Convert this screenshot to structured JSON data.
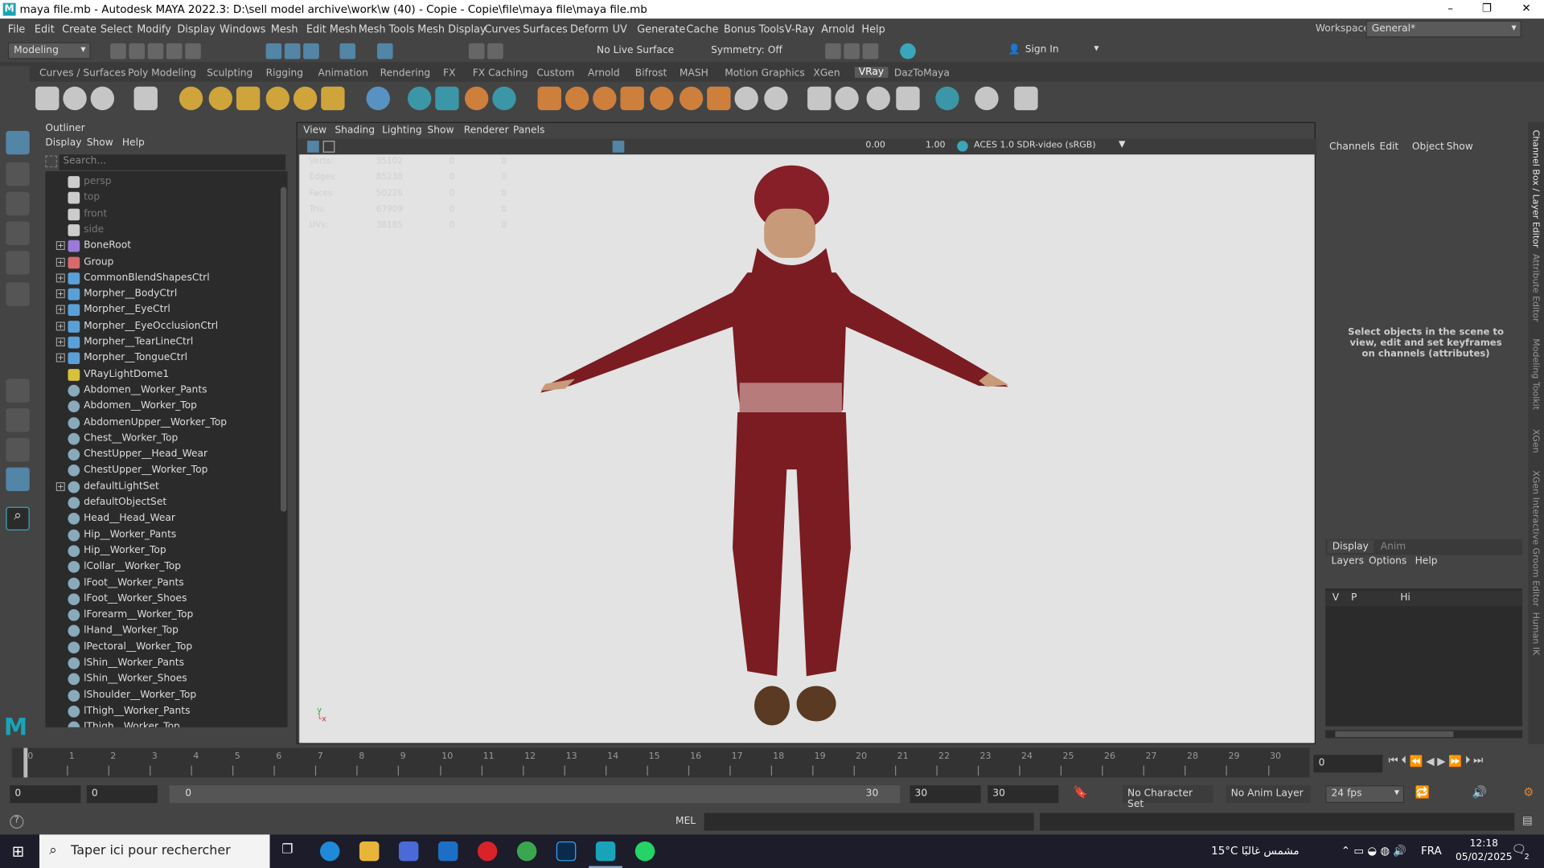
{
  "window": {
    "title": "maya file.mb - Autodesk MAYA 2022.3: D:\\sell model archive\\work\\w (40) - Copie - Copie\\file\\maya file\\maya file.mb"
  },
  "menus": [
    "File",
    "Edit",
    "Create",
    "Select",
    "Modify",
    "Display",
    "Windows",
    "Mesh",
    "Edit Mesh",
    "Mesh Tools",
    "Mesh Display",
    "Curves",
    "Surfaces",
    "Deform",
    "UV",
    "Generate",
    "Cache",
    "Bonus Tools",
    "V-Ray",
    "Arnold",
    "Help"
  ],
  "workspace": {
    "label": "Workspace:",
    "value": "General*"
  },
  "status": {
    "mode": "Modeling",
    "live_surface": "No Live Surface",
    "symmetry": "Symmetry: Off",
    "sign_in": "Sign In"
  },
  "shelf_tabs": [
    "Curves / Surfaces",
    "Poly Modeling",
    "Sculpting",
    "Rigging",
    "Animation",
    "Rendering",
    "FX",
    "FX Caching",
    "Custom",
    "Arnold",
    "Bifrost",
    "MASH",
    "Motion Graphics",
    "XGen",
    "VRay",
    "DazToMaya"
  ],
  "shelf_active": "VRay",
  "outliner": {
    "title": "Outliner",
    "menu": [
      "Display",
      "Show",
      "Help"
    ],
    "search_placeholder": "Search...",
    "items": [
      {
        "label": "persp",
        "type": "camera"
      },
      {
        "label": "top",
        "type": "camera"
      },
      {
        "label": "front",
        "type": "camera"
      },
      {
        "label": "side",
        "type": "camera"
      },
      {
        "label": "BoneRoot",
        "type": "joint",
        "expand": true
      },
      {
        "label": "Group",
        "type": "group",
        "expand": true
      },
      {
        "label": "CommonBlendShapesCtrl",
        "type": "curve",
        "expand": true
      },
      {
        "label": "Morpher__BodyCtrl",
        "type": "curve",
        "expand": true
      },
      {
        "label": "Morpher__EyeCtrl",
        "type": "curve",
        "expand": true
      },
      {
        "label": "Morpher__EyeOcclusionCtrl",
        "type": "curve",
        "expand": true
      },
      {
        "label": "Morpher__TearLineCtrl",
        "type": "curve",
        "expand": true
      },
      {
        "label": "Morpher__TongueCtrl",
        "type": "curve",
        "expand": true
      },
      {
        "label": "VRayLightDome1",
        "type": "light"
      },
      {
        "label": "Abdomen__Worker_Pants",
        "type": "set"
      },
      {
        "label": "Abdomen__Worker_Top",
        "type": "set"
      },
      {
        "label": "AbdomenUpper__Worker_Top",
        "type": "set"
      },
      {
        "label": "Chest__Worker_Top",
        "type": "set"
      },
      {
        "label": "ChestUpper__Head_Wear",
        "type": "set"
      },
      {
        "label": "ChestUpper__Worker_Top",
        "type": "set"
      },
      {
        "label": "defaultLightSet",
        "type": "set",
        "expand": true
      },
      {
        "label": "defaultObjectSet",
        "type": "set"
      },
      {
        "label": "Head__Head_Wear",
        "type": "set"
      },
      {
        "label": "Hip__Worker_Pants",
        "type": "set"
      },
      {
        "label": "Hip__Worker_Top",
        "type": "set"
      },
      {
        "label": "lCollar__Worker_Top",
        "type": "set"
      },
      {
        "label": "lFoot__Worker_Pants",
        "type": "set"
      },
      {
        "label": "lFoot__Worker_Shoes",
        "type": "set"
      },
      {
        "label": "lForearm__Worker_Top",
        "type": "set"
      },
      {
        "label": "lHand__Worker_Top",
        "type": "set"
      },
      {
        "label": "lPectoral__Worker_Top",
        "type": "set"
      },
      {
        "label": "lShin__Worker_Pants",
        "type": "set"
      },
      {
        "label": "lShin__Worker_Shoes",
        "type": "set"
      },
      {
        "label": "lShoulder__Worker_Top",
        "type": "set"
      },
      {
        "label": "lThigh__Worker_Pants",
        "type": "set"
      },
      {
        "label": "lThigh__Worker_Top",
        "type": "set"
      }
    ]
  },
  "viewport": {
    "menu": [
      "View",
      "Shading",
      "Lighting",
      "Show",
      "Renderer",
      "Panels"
    ],
    "exposure": "0.00",
    "gamma": "1.00",
    "colorspace": "ACES 1.0 SDR-video (sRGB)",
    "hud": [
      {
        "label": "Verts:",
        "v": "35102",
        "a": "0",
        "b": "0"
      },
      {
        "label": "Edges:",
        "v": "85238",
        "a": "0",
        "b": "0"
      },
      {
        "label": "Faces:",
        "v": "50226",
        "a": "0",
        "b": "0"
      },
      {
        "label": "Tris:",
        "v": "67909",
        "a": "0",
        "b": "0"
      },
      {
        "label": "UVs:",
        "v": "38185",
        "a": "0",
        "b": "0"
      }
    ]
  },
  "channelbox": {
    "menu": [
      "Channels",
      "Edit",
      "Object",
      "Show"
    ],
    "hint": "Select objects in the scene to view, edit and set keyframes on channels (attributes)",
    "layer_tabs": [
      "Display",
      "Anim"
    ],
    "layer_menu": [
      "Layers",
      "Options",
      "Help"
    ],
    "layer_row": {
      "v": "V",
      "p": "P",
      "name": "Hi"
    }
  },
  "side_tabs": [
    "Channel Box / Layer Editor",
    "Attribute Editor",
    "Modeling Toolkit",
    "XGen",
    "XGen Interactive Groom Editor",
    "Human IK"
  ],
  "timeline": {
    "ticks": [
      "0",
      "1",
      "2",
      "3",
      "4",
      "5",
      "6",
      "7",
      "8",
      "9",
      "10",
      "11",
      "12",
      "13",
      "14",
      "15",
      "16",
      "17",
      "18",
      "19",
      "20",
      "21",
      "22",
      "23",
      "24",
      "25",
      "26",
      "27",
      "28",
      "29",
      "30"
    ],
    "current_frame": "0"
  },
  "range": {
    "start": "0",
    "inner_start": "0",
    "slider_start": "0",
    "slider_end": "30",
    "inner_end": "30",
    "end": "30",
    "character_set": "No Character Set",
    "anim_layer": "No Anim Layer",
    "fps": "24 fps"
  },
  "cmdline": {
    "label": "MEL"
  },
  "taskbar": {
    "search": "Taper ici pour rechercher",
    "weather": "15°C  مشمس غالبًا",
    "lang": "FRA",
    "time": "12:18",
    "date": "05/02/2025",
    "notif": "2"
  }
}
